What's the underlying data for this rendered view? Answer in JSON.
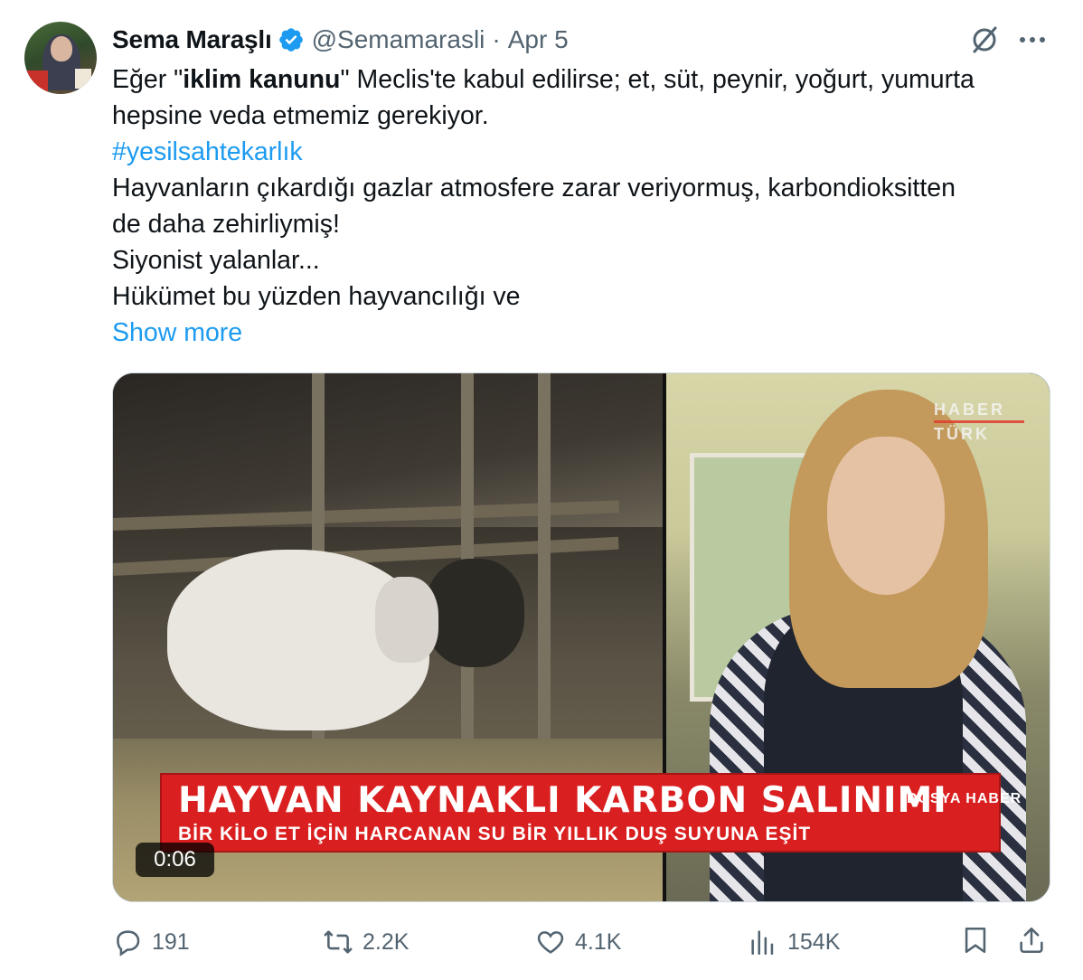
{
  "author": {
    "name": "Sema Maraşlı",
    "handle": "@Semamarasli",
    "separator": "·",
    "date": "Apr 5",
    "verified_color": "#1d9bf0"
  },
  "tweet": {
    "line1_pre": "Eğer \"",
    "line1_bold": "iklim kanunu",
    "line1_post": "\" Meclis'te kabul edilirse; et, süt, peynir, yoğurt, yumurta",
    "line2": "hepsine veda etmemiz gerekiyor.",
    "hashtag": "#yesilsahtekarlık",
    "line4": "Hayvanların çıkardığı gazlar atmosfere zarar veriyormuş, karbondioksitten",
    "line5": "de daha zehirliymiş!",
    "line6": "Siyonist yalanlar...",
    "line7": "Hükümet bu yüzden hayvancılığı ve",
    "show_more": "Show more"
  },
  "video": {
    "channel_logo_line1": "HABER",
    "channel_logo_line2": "TÜRK",
    "banner_title": "HAYVAN KAYNAKLI KARBON SALINIMI",
    "banner_tag": "DOSYA HABER",
    "banner_sub": "BİR KİLO ET İÇİN HARCANAN SU BİR YILLIK DUŞ SUYUNA EŞİT",
    "duration": "0:06"
  },
  "actions": {
    "replies": "191",
    "reposts": "2.2K",
    "likes": "4.1K",
    "views": "154K"
  },
  "icons": [
    "verified-badge-icon",
    "grok-icon",
    "more-icon",
    "reply-icon",
    "repost-icon",
    "like-icon",
    "views-icon",
    "bookmark-icon",
    "share-icon"
  ],
  "colors": {
    "text": "#0f1419",
    "secondary": "#536471",
    "link": "#1d9bf0",
    "banner": "#d91f1f"
  }
}
